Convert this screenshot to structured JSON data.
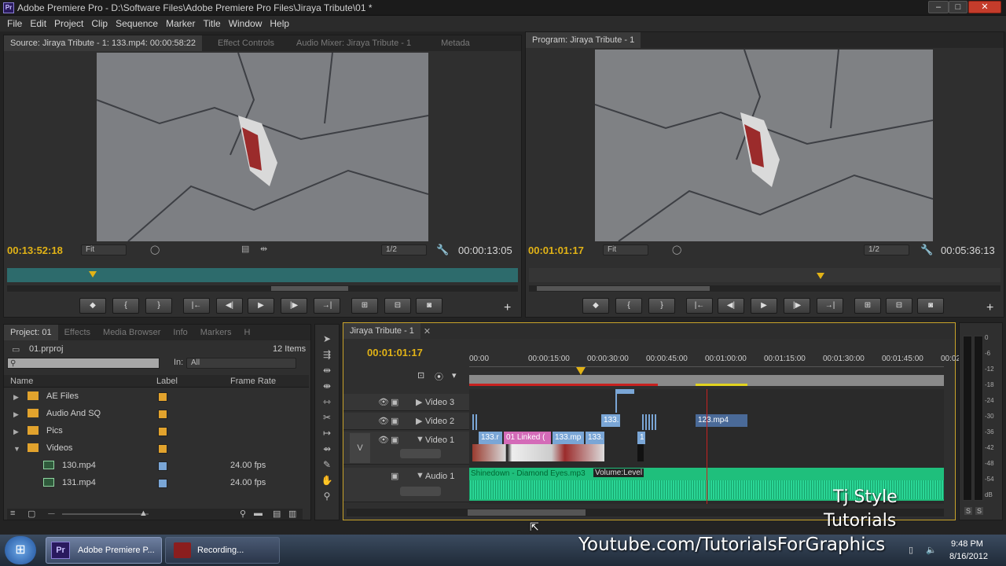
{
  "window": {
    "title": "Adobe Premiere Pro - D:\\Software Files\\Adobe Premiere Pro Files\\Jiraya Tribute\\01 *",
    "icon": "Pr"
  },
  "menu": [
    "File",
    "Edit",
    "Project",
    "Clip",
    "Sequence",
    "Marker",
    "Title",
    "Window",
    "Help"
  ],
  "source_monitor": {
    "tabs": [
      "Source: Jiraya Tribute - 1: 133.mp4: 00:00:58:22",
      "Effect Controls",
      "Audio Mixer: Jiraya Tribute - 1",
      "Metada"
    ],
    "timecode_in": "00:13:52:18",
    "fit": "Fit",
    "resolution": "1/2",
    "duration": "00:00:13:05"
  },
  "program_monitor": {
    "tabs": [
      "Program: Jiraya Tribute - 1"
    ],
    "timecode_in": "00:01:01:17",
    "fit": "Fit",
    "resolution": "1/2",
    "duration": "00:05:36:13"
  },
  "project_panel": {
    "tabs": [
      "Project: 01",
      "Effects",
      "Media Browser",
      "Info",
      "Markers",
      "H"
    ],
    "file": "01.prproj",
    "count": "12 Items",
    "in_label": "In:",
    "in_value": "All",
    "columns": [
      "Name",
      "Label",
      "Frame Rate"
    ],
    "items": [
      {
        "name": "AE Files",
        "type": "folder",
        "rate": ""
      },
      {
        "name": "Audio And SQ",
        "type": "folder",
        "rate": ""
      },
      {
        "name": "Pics",
        "type": "folder",
        "rate": ""
      },
      {
        "name": "Videos",
        "type": "folder",
        "rate": ""
      },
      {
        "name": "130.mp4",
        "type": "clip",
        "rate": "24.00 fps"
      },
      {
        "name": "131.mp4",
        "type": "clip",
        "rate": "24.00 fps"
      }
    ]
  },
  "timeline": {
    "tab": "Jiraya Tribute - 1",
    "timecode": "00:01:01:17",
    "ruler": [
      "00:00",
      "00:00:15:00",
      "00:00:30:00",
      "00:00:45:00",
      "00:01:00:00",
      "00:01:15:00",
      "00:01:30:00",
      "00:01:45:00",
      "00:02:00"
    ],
    "tracks": [
      "Video 3",
      "Video 2",
      "Video 1",
      "Audio 1"
    ],
    "track_v_label": "V",
    "clips_v1": [
      "133.r",
      "01 Linked (",
      "133.mp",
      "133.",
      "1"
    ],
    "clips_v2": [
      "133.",
      "123.mp4"
    ],
    "audio_clip": "Shinedown - Diamond Eyes.mp3",
    "audio_volume": "Volume:Level"
  },
  "meter": {
    "labels": [
      "0",
      "-6",
      "-12",
      "-18",
      "-24",
      "-30",
      "-36",
      "-42",
      "-48",
      "-54",
      "dB"
    ]
  },
  "overlay": {
    "line1": "Tj Style",
    "line2": "Tutorials",
    "url": "Youtube.com/TutorialsForGraphics"
  },
  "taskbar": {
    "app1": "Adobe Premiere P...",
    "app2": "Recording...",
    "time": "9:48 PM",
    "date": "8/16/2012"
  }
}
